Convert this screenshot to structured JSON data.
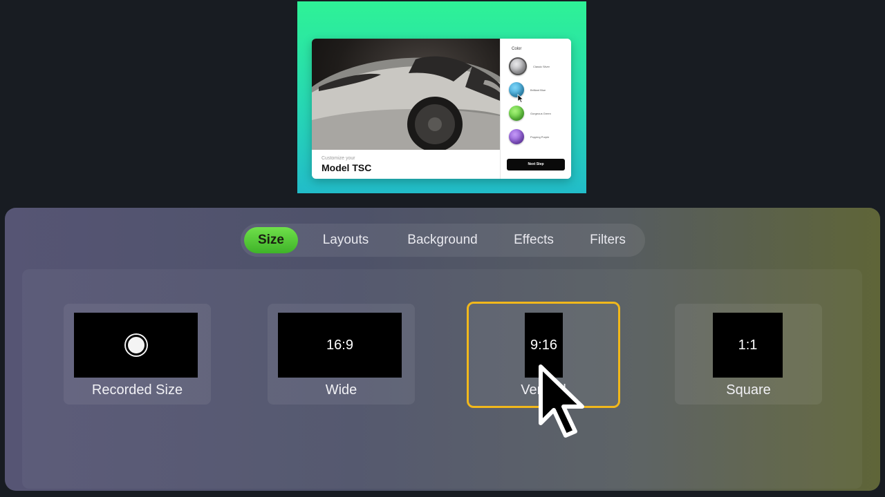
{
  "preview": {
    "kicker": "Customize your",
    "model": "Model TSC",
    "color_heading": "Color",
    "swatches": [
      {
        "label": "Classic Silver",
        "color": "#b9b9bd"
      },
      {
        "label": "Brilliant Blue",
        "color": "#2aa5d8"
      },
      {
        "label": "Gorgeous Green",
        "color": "#5ad12f"
      },
      {
        "label": "Popping Purple",
        "color": "#8d4ed8"
      }
    ],
    "next_button": "Next Step"
  },
  "tabs": [
    {
      "label": "Size",
      "active": true
    },
    {
      "label": "Layouts",
      "active": false
    },
    {
      "label": "Background",
      "active": false
    },
    {
      "label": "Effects",
      "active": false
    },
    {
      "label": "Filters",
      "active": false
    }
  ],
  "size_options": [
    {
      "thumb_text": "",
      "label": "Recorded Size",
      "selected": false
    },
    {
      "thumb_text": "16:9",
      "label": "Wide",
      "selected": false
    },
    {
      "thumb_text": "9:16",
      "label": "Vertical",
      "selected": true
    },
    {
      "thumb_text": "1:1",
      "label": "Square",
      "selected": false
    }
  ],
  "colors": {
    "accent_green": "#4fcf2f",
    "selection_outline": "#f2b81b"
  }
}
